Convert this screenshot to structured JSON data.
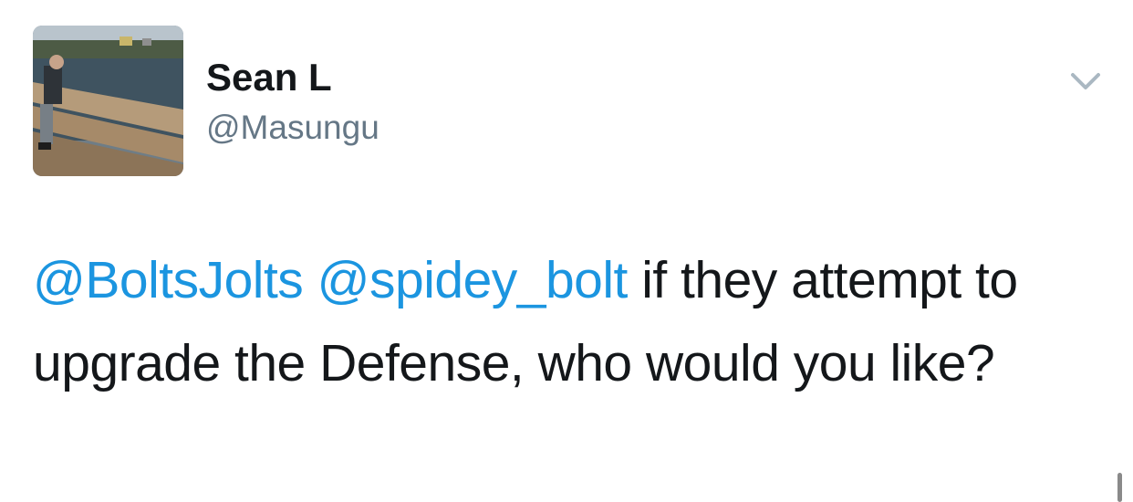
{
  "tweet": {
    "author": {
      "display_name": "Sean L",
      "handle": "@Masungu"
    },
    "text": {
      "mention_1": "@BoltsJolts",
      "space_1": " ",
      "mention_2": "@spidey_bolt",
      "body": " if they attempt to upgrade the Defense, who would you like?"
    },
    "icons": {
      "avatar": "avatar-photo",
      "menu": "chevron-down-icon"
    }
  },
  "colors": {
    "link": "#1b95e0",
    "text": "#14171a",
    "secondary": "#657786",
    "chevron": "#aab8c2"
  }
}
